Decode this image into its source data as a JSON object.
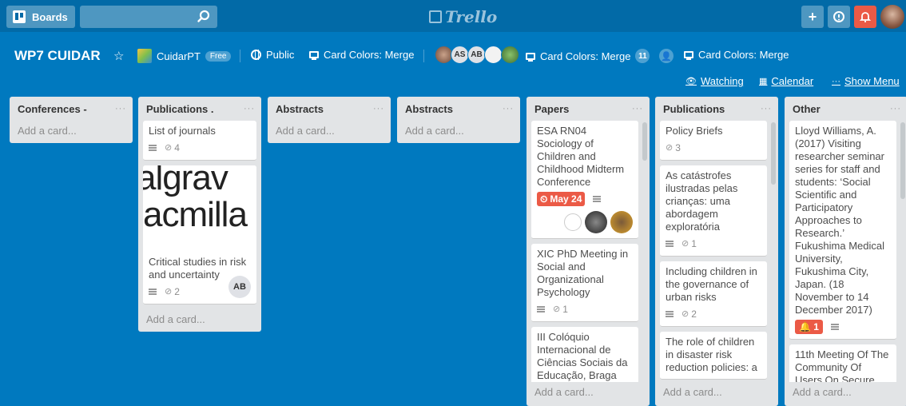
{
  "header": {
    "boards_label": "Boards",
    "logo_text": "Trello",
    "add_label": "+",
    "info_label": "ⓘ",
    "notif_label": "🔔"
  },
  "board": {
    "title": "WP7 CUIDAR",
    "team": "CuidarPT",
    "team_badge": "Free",
    "visibility": "Public",
    "powerup_1": "Card Colors: Merge",
    "members": [
      "AS",
      "AB"
    ],
    "powerup_2": "Card Colors: Merge",
    "member_count": "11",
    "powerup_3": "Card Colors: Merge",
    "watching": "Watching",
    "calendar": "Calendar",
    "show_menu": "Show Menu"
  },
  "lists": [
    {
      "title": "Conferences -",
      "add_label": "Add a card..."
    },
    {
      "title": "Publications .",
      "add_label": "Add a card...",
      "cards": [
        {
          "text": "List of journals",
          "attachments": "4"
        },
        {
          "cover_line1": "algrav",
          "cover_line2": "acmilla",
          "text": "Critical studies in risk and uncertainty",
          "attachments": "2",
          "member": "AB"
        }
      ]
    },
    {
      "title": "Abstracts",
      "add_label": "Add a card..."
    },
    {
      "title": "Abstracts",
      "add_label": "Add a card..."
    },
    {
      "title": "Papers",
      "add_label": "Add a card...",
      "cards": [
        {
          "text": "ESA RN04 Sociology of Children and Childhood Midterm Conference",
          "due": "May 24"
        },
        {
          "text": "XIC PhD Meeting in Social and Organizational Psychology",
          "attachments": "1"
        },
        {
          "text": "III Colóquio Internacional de Ciências Sociais da Educação, Braga"
        }
      ]
    },
    {
      "title": "Publications",
      "add_label": "Add a card...",
      "cards": [
        {
          "text": "Policy Briefs",
          "attachments": "3"
        },
        {
          "text": "As catástrofes ilustradas pelas crianças: uma abordagem exploratória",
          "attachments": "1"
        },
        {
          "text": "Including children in the governance of urban risks",
          "attachments": "2"
        },
        {
          "text": "The role of children in disaster risk reduction policies: a"
        }
      ]
    },
    {
      "title": "Other",
      "add_label": "Add a card...",
      "cards": [
        {
          "text": "Lloyd Williams, A. (2017) Visiting researcher seminar series for staff and students: ‘Social Scientific and Participatory Approaches to Research.’ Fukushima Medical University, Fukushima City, Japan. (18 November to 14 December 2017)",
          "alerts": "1"
        },
        {
          "text": "11th Meeting Of The Community Of Users On Secure"
        }
      ]
    }
  ]
}
